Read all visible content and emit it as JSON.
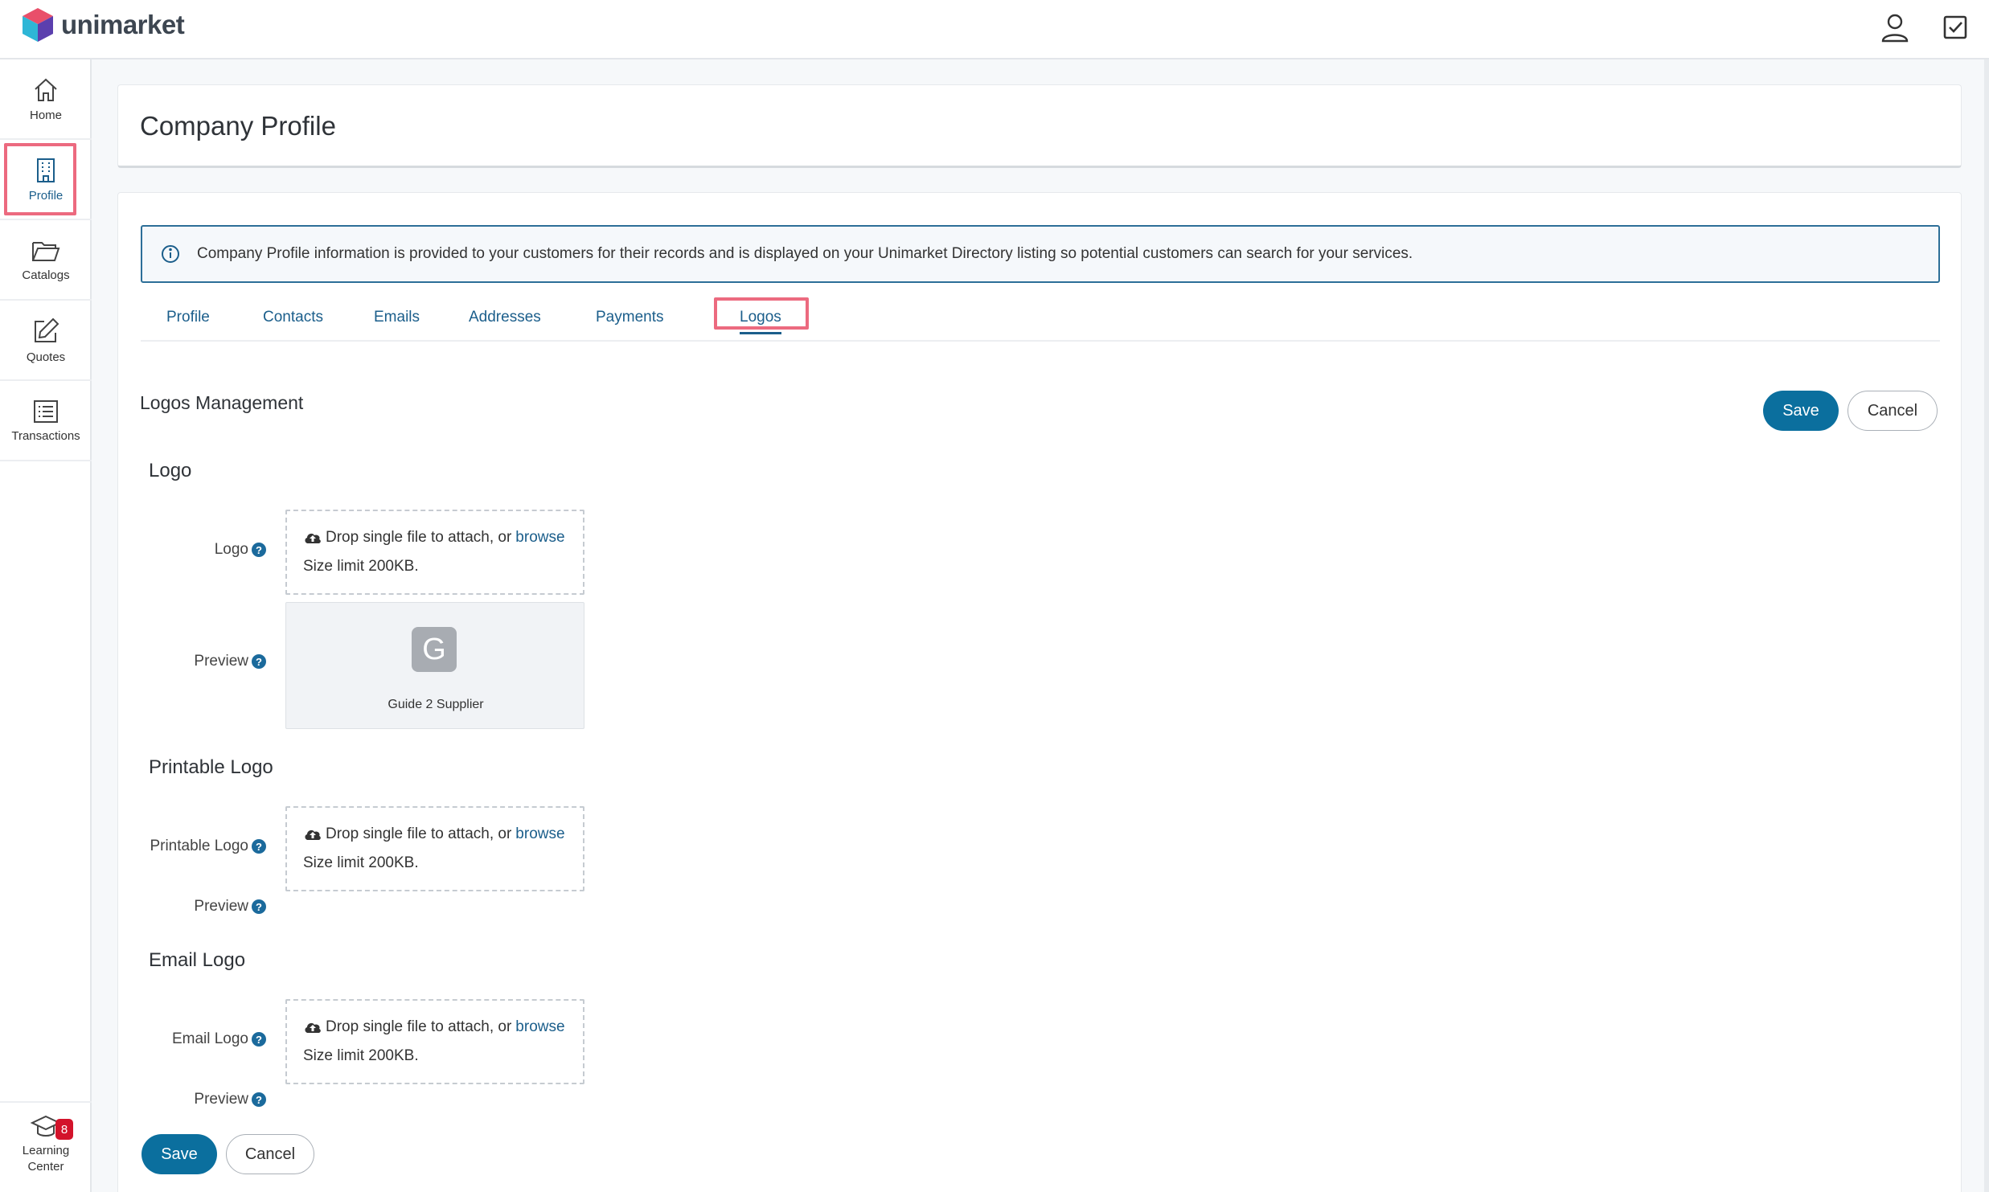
{
  "app": {
    "brand": "unimarket"
  },
  "sidebar": {
    "items": [
      {
        "label": "Home"
      },
      {
        "label": "Profile"
      },
      {
        "label": "Catalogs"
      },
      {
        "label": "Quotes"
      },
      {
        "label": "Transactions"
      }
    ],
    "learning": {
      "label_line1": "Learning",
      "label_line2": "Center",
      "badge": "8"
    }
  },
  "header": {
    "title": "Company Profile"
  },
  "info": {
    "text": "Company Profile information is provided to your customers for their records and is displayed on your Unimarket Directory listing so potential customers can search for your services."
  },
  "tabs": [
    "Profile",
    "Contacts",
    "Emails",
    "Addresses",
    "Payments",
    "Logos"
  ],
  "logos": {
    "heading": "Logos Management",
    "save": "Save",
    "cancel": "Cancel",
    "logo": {
      "heading": "Logo",
      "field_label": "Logo",
      "preview_label": "Preview",
      "preview_letter": "G",
      "preview_name": "Guide 2 Supplier"
    },
    "printable": {
      "heading": "Printable Logo",
      "field_label": "Printable Logo",
      "preview_label": "Preview"
    },
    "email": {
      "heading": "Email Logo",
      "field_label": "Email Logo",
      "preview_label": "Preview"
    },
    "dropzone": {
      "drop_text": "Drop single file to attach, or",
      "browse": "browse",
      "size_limit": "Size limit 200KB."
    },
    "help": "?"
  },
  "colors": {
    "primary": "#0b6f9e",
    "highlight": "#ec6a7f",
    "link": "#1b5e8b"
  }
}
